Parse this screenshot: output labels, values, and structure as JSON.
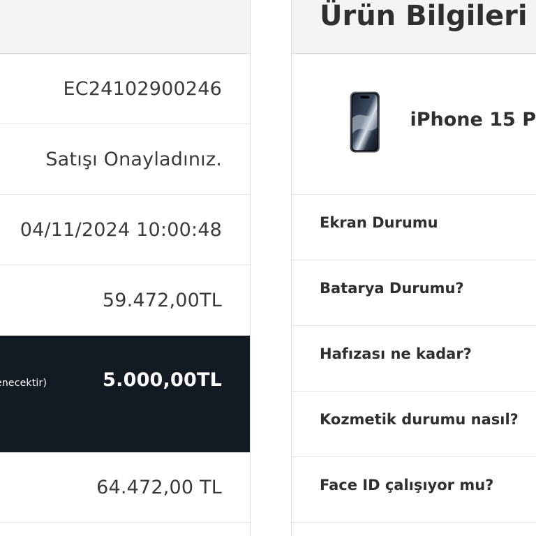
{
  "left": {
    "order_code": "EC24102900246",
    "status": "Satışı Onayladınız.",
    "datetime": "04/11/2024 10:00:48",
    "price": "59.472,00TL",
    "bonus_note": "enecektir)",
    "bonus_amount": "5.000,00TL",
    "total": "64.472,00 TL"
  },
  "right": {
    "title": "Ürün Bilgileri",
    "product_name": "iPhone 15 P",
    "questions": [
      "Ekran Durumu",
      "Batarya Durumu?",
      "Hafızası ne kadar?",
      "Kozmetik durumu nasıl?",
      "Face ID çalışıyor mu?"
    ]
  },
  "colors": {
    "dark_row": "#141a22",
    "header_bg": "#f4f4f4"
  },
  "icons": {
    "product_image": "iphone-15-pro-icon"
  }
}
